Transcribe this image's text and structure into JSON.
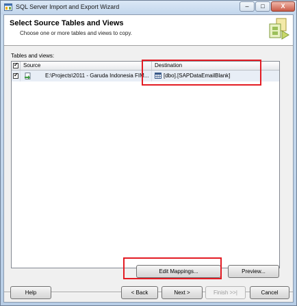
{
  "window": {
    "title": "SQL Server Import and Export Wizard",
    "controls": {
      "minimize": "–",
      "maximize": "□",
      "close": "X"
    }
  },
  "header": {
    "title": "Select Source Tables and Views",
    "subtitle": "Choose one or more tables and views to copy.",
    "icon": "wizard-graphic-icon"
  },
  "grid": {
    "label": "Tables and views:",
    "columns": [
      "Source",
      "Destination"
    ],
    "header_checked": true,
    "rows": [
      {
        "checked": true,
        "source": "E:\\Projects\\2011 - Garuda Indonesia FIM...",
        "destination": "[dbo].[SAPDataEmailBlank]",
        "source_icon": "file-source-icon",
        "destination_icon": "table-icon"
      }
    ]
  },
  "buttons": {
    "edit_mappings": "Edit Mappings...",
    "preview": "Preview...",
    "help": "Help",
    "back": "< Back",
    "next": "Next >",
    "finish": "Finish >>|",
    "cancel": "Cancel"
  },
  "colors": {
    "highlight": "#e31b23",
    "row_selected": "#e8eef6"
  }
}
